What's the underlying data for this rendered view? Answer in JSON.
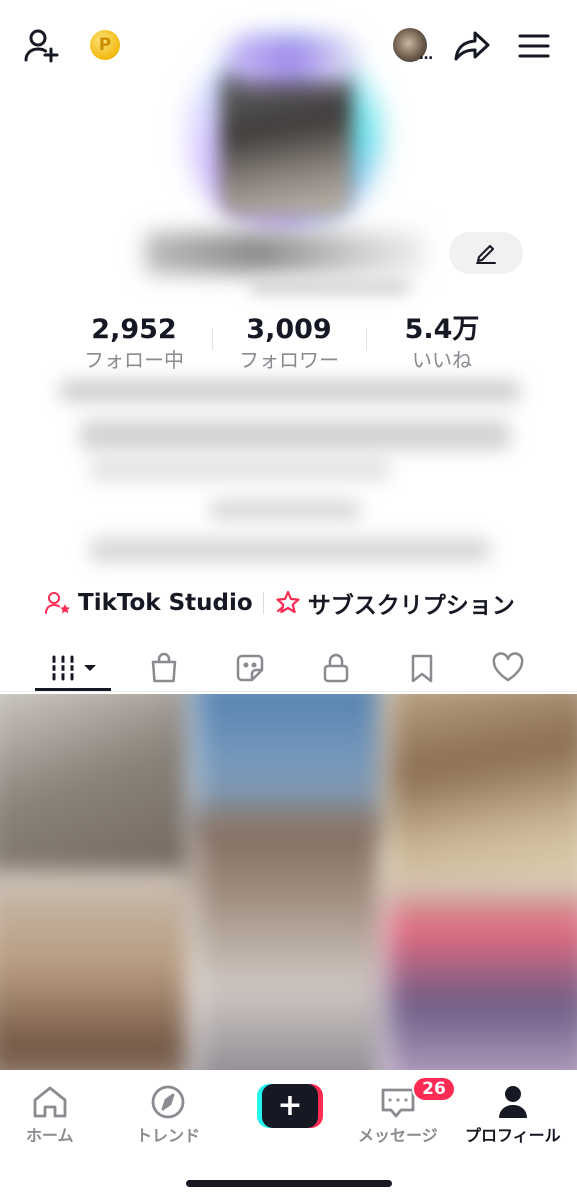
{
  "topbar": {
    "add_friend_icon": "add-user-icon",
    "coin_label": "P",
    "more_dots": "…",
    "share_icon": "share-arrow-icon",
    "menu_icon": "hamburger-menu-icon"
  },
  "profile": {
    "stats": [
      {
        "value": "2,952",
        "label": "フォロー中"
      },
      {
        "value": "3,009",
        "label": "フォロワー"
      },
      {
        "value": "5.4万",
        "label": "いいね"
      }
    ],
    "studio_label": "TikTok Studio",
    "subscription_label": "サブスクリプション"
  },
  "tabs": [
    {
      "name": "videos",
      "icon": "grid-icon"
    },
    {
      "name": "shop",
      "icon": "shopping-bag-icon"
    },
    {
      "name": "stickers",
      "icon": "sticker-icon"
    },
    {
      "name": "private",
      "icon": "lock-icon"
    },
    {
      "name": "saved",
      "icon": "bookmark-icon"
    },
    {
      "name": "liked",
      "icon": "heart-icon"
    }
  ],
  "bottom_nav": {
    "home": "ホーム",
    "trend": "トレンド",
    "create_label": "+",
    "messages": "メッセージ",
    "messages_badge": "26",
    "profile": "プロフィール"
  },
  "colors": {
    "brand_red": "#fe2c55",
    "brand_cyan": "#25f4ee",
    "text_primary": "#161823",
    "text_secondary": "#8a8b91"
  }
}
